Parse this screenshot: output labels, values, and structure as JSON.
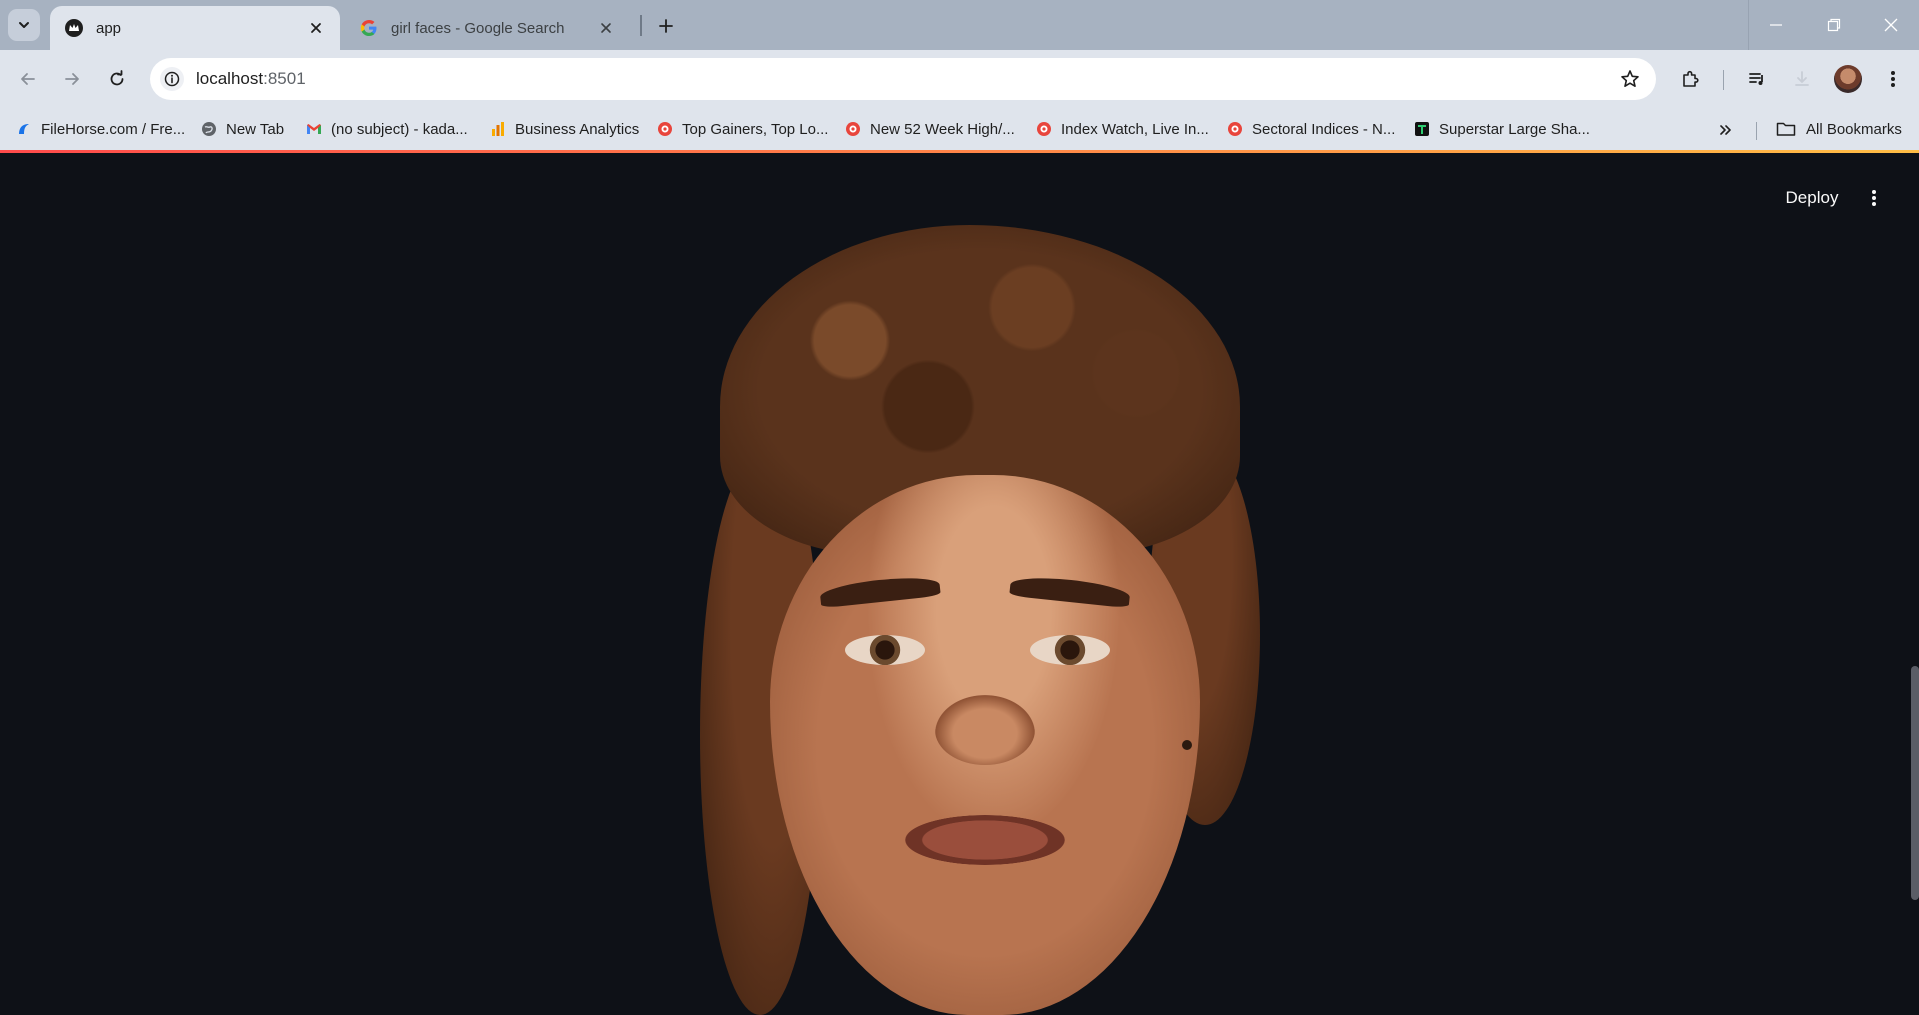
{
  "tabs": [
    {
      "title": "app",
      "active": true,
      "favicon": "streamlit-crown-icon"
    },
    {
      "title": "girl faces - Google Search",
      "active": false,
      "favicon": "google-g-icon"
    }
  ],
  "address_bar": {
    "host": "localhost",
    "port": ":8501"
  },
  "bookmarks": [
    {
      "label": "FileHorse.com / Fre...",
      "icon": "filehorse-icon"
    },
    {
      "label": "New Tab",
      "icon": "globe-icon"
    },
    {
      "label": "(no subject) - kada...",
      "icon": "gmail-icon"
    },
    {
      "label": "Business Analytics",
      "icon": "analytics-icon"
    },
    {
      "label": "Top Gainers, Top Lo...",
      "icon": "moneycontrol-icon"
    },
    {
      "label": "New 52 Week High/...",
      "icon": "moneycontrol-icon"
    },
    {
      "label": "Index Watch, Live In...",
      "icon": "moneycontrol-icon"
    },
    {
      "label": "Sectoral Indices - N...",
      "icon": "moneycontrol-icon"
    },
    {
      "label": "Superstar Large Sha...",
      "icon": "trendlyne-icon"
    }
  ],
  "all_bookmarks_label": "All Bookmarks",
  "app": {
    "deploy_label": "Deploy"
  },
  "colors": {
    "page_background": "#0e1117",
    "browser_chrome": "#dfe4ec",
    "tabstrip": "#a7b2c1",
    "accent_red": "#ff4b4b"
  }
}
